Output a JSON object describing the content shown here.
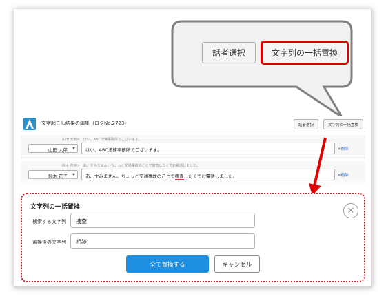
{
  "callout": {
    "speaker_select_label": "話者選択",
    "bulk_replace_label": "文字列の一括置換"
  },
  "app": {
    "title": "文字起こし結果の編集（ログNo.2723）",
    "speaker_select_label": "話者選択",
    "bulk_replace_label": "文字列の一括置換",
    "segments": [
      {
        "original": "山田 太郎>　はい、ABC法律事務所でございます。",
        "speaker": "山田 太郎",
        "text": "はい、ABC法律事務所でございます。",
        "delete_label": "✕削除"
      },
      {
        "original": "鈴木 花子>　あ、すみません。ちょっと交通事故のことで捜査したくてお電話しました。",
        "speaker": "鈴木 花子",
        "text_before": "あ、すみません。ちょっと交通事故のことで",
        "text_highlight": "捜査",
        "text_after": "したくてお電話しました。",
        "delete_label": "✕削除"
      }
    ]
  },
  "replace_dialog": {
    "title": "文字列の一括置換",
    "search_label": "検索する文字列",
    "search_value": "捜査",
    "replace_label": "置換後の文字列",
    "replace_value": "相談",
    "replace_all_label": "全て置換する",
    "cancel_label": "キャンセル"
  },
  "colors": {
    "accent_red": "#e00000",
    "primary_blue": "#1e8fe1",
    "logo_blue": "#2f8fc4"
  }
}
